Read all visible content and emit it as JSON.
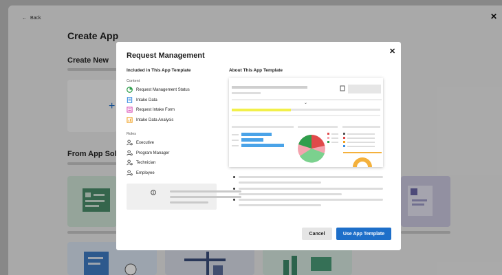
{
  "page": {
    "back_label": "Back",
    "title": "Create App",
    "create_new_heading": "Create New",
    "from_solutions_heading": "From App Solu"
  },
  "modal": {
    "title": "Request Management",
    "included_heading": "Included in This App Template",
    "about_heading": "About This App Template",
    "content_label": "Content",
    "content_items": [
      {
        "label": "Request Management Status",
        "icon": "status-chart-icon",
        "color": "#2f9e4c"
      },
      {
        "label": "Intake Data",
        "icon": "data-sheet-icon",
        "color": "#3a8de0"
      },
      {
        "label": "Request Intake Form",
        "icon": "form-icon",
        "color": "#d94fb5"
      },
      {
        "label": "Intake Data Analysis",
        "icon": "analysis-icon",
        "color": "#f0a020"
      }
    ],
    "roles_label": "Roles",
    "roles": [
      "Executive",
      "Program Manager",
      "Technician",
      "Employee"
    ],
    "cancel_label": "Cancel",
    "use_label": "Use App Template"
  },
  "colors": {
    "primary": "#1e6fc9",
    "highlight": "#f2f04a",
    "bar": "#4aa3e8",
    "donut": "#f4b13c"
  }
}
